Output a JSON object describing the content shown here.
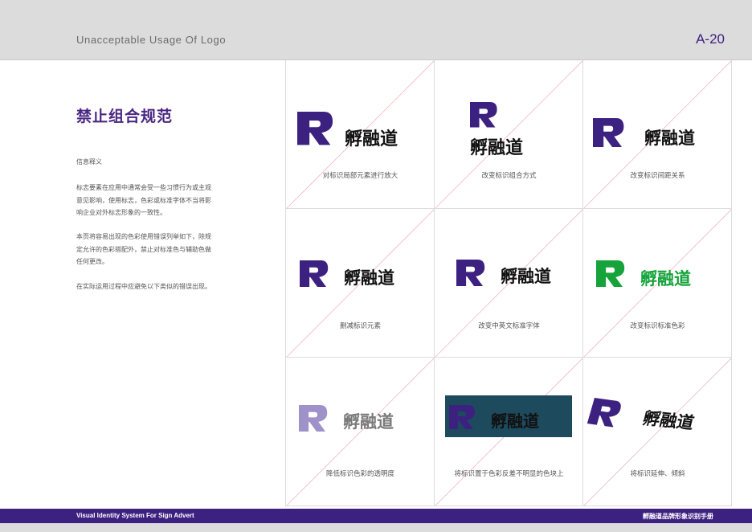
{
  "header": {
    "title": "Unacceptable Usage Of Logo",
    "page": "A-20"
  },
  "side": {
    "title": "禁止组合规范",
    "subtitle": "信息释义",
    "paragraphs": [
      [
        "标志要素在应用中通常会受一些习惯行为或主观",
        "意见影响，使用标志，色彩或标准字体不当将影",
        "响企业对外标志形象的一致性。"
      ],
      [
        "本页将容易出现的色彩使用错误列举如下，除规",
        "定允许的色彩搭配外，禁止对标准色与辅助色做",
        "任何更改。"
      ],
      [
        "在实际运用过程中应避免以下类似的错误出现。"
      ]
    ]
  },
  "brand": {
    "wordmark": "孵融道",
    "purple": "#3d2180",
    "green": "#16a33b",
    "light_purple": "#9f92c8",
    "gray": "#7a7a7a",
    "dark_block": "#1e4a5e"
  },
  "cells": [
    {
      "caption": "对标识局部元素进行放大"
    },
    {
      "caption": "改变标识组合方式"
    },
    {
      "caption": "改变标识间距关系"
    },
    {
      "caption": "删减标识元素"
    },
    {
      "caption": "改变中英文标准字体"
    },
    {
      "caption": "改变标识标准色彩"
    },
    {
      "caption": "降低标识色彩的透明度"
    },
    {
      "caption": "将标识置于色彩反差不明显的色块上"
    },
    {
      "caption": "将标识延伸、倾斜"
    }
  ],
  "footer": {
    "left": "Visual Identity System For Sign Advert",
    "right": "孵融道品牌形象识别手册"
  }
}
